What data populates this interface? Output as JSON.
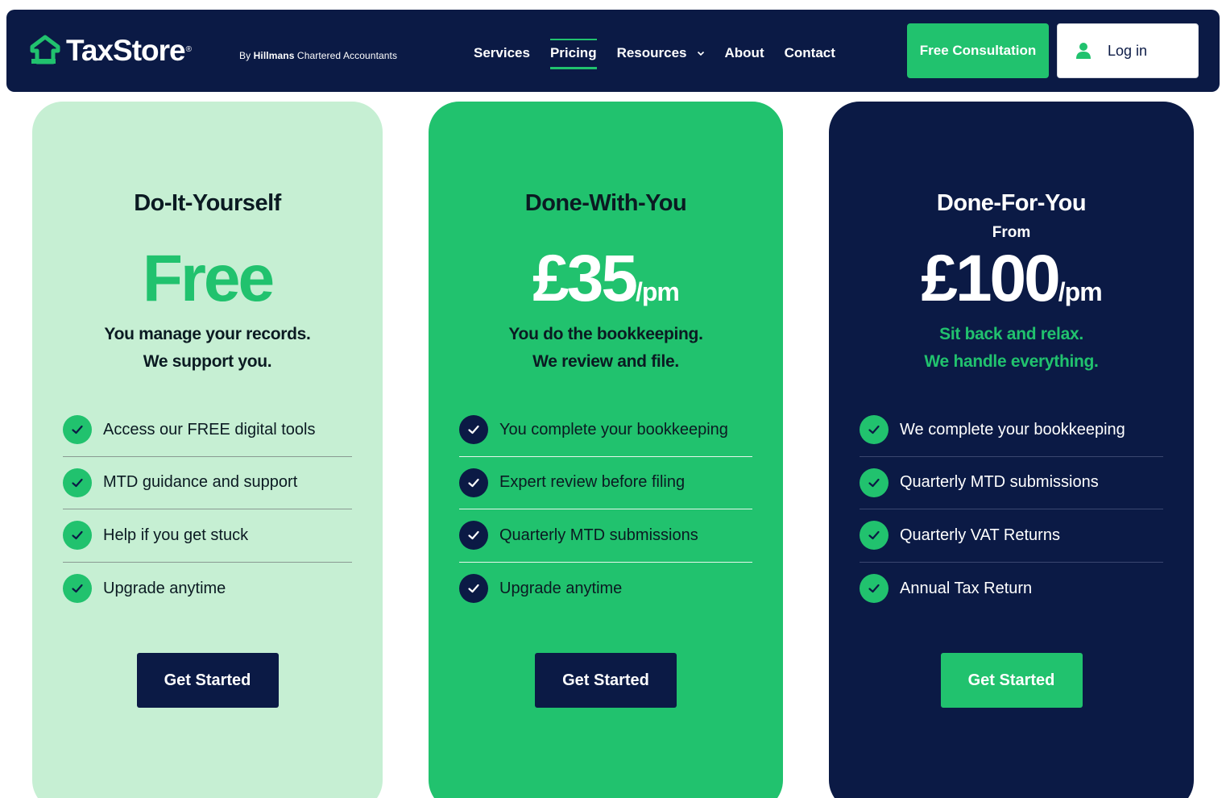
{
  "brand": {
    "name": "TaxStore",
    "registered": "®",
    "byline_prefix": "By",
    "byline_company": "Hillmans",
    "byline_suffix": "Chartered Accountants"
  },
  "nav": {
    "items": [
      {
        "label": "Services"
      },
      {
        "label": "Pricing",
        "active": true
      },
      {
        "label": "Resources"
      },
      {
        "label": "About"
      },
      {
        "label": "Contact"
      }
    ],
    "consult_label": "Free Consultation",
    "login_label": "Log in"
  },
  "colors": {
    "navy": "#0b1a45",
    "green": "#21c26e",
    "mint": "#c6efd3"
  },
  "plans": [
    {
      "title": "Do-It-Yourself",
      "price": "Free",
      "per": "",
      "tagline_1": "You manage your records.",
      "tagline_2": "We support you.",
      "features": [
        "Access our FREE digital tools",
        "MTD guidance and support",
        "Help if you get stuck",
        "Upgrade anytime"
      ],
      "cta": "Get Started"
    },
    {
      "title": "Done-With-You",
      "price": "£35",
      "per": "/pm",
      "tagline_1": "You do the bookkeeping.",
      "tagline_2": "We review and file.",
      "features": [
        "You complete your bookkeeping",
        "Expert review before filing",
        "Quarterly MTD submissions",
        "Upgrade anytime"
      ],
      "cta": "Get Started"
    },
    {
      "title": "Done-For-You",
      "from": "From",
      "price": "£100",
      "per": "/pm",
      "tagline_1": "Sit back and relax.",
      "tagline_2": "We handle everything.",
      "features": [
        "We complete your bookkeeping",
        "Quarterly MTD submissions",
        "Quarterly VAT Returns",
        "Annual Tax Return"
      ],
      "cta": "Get Started"
    }
  ]
}
